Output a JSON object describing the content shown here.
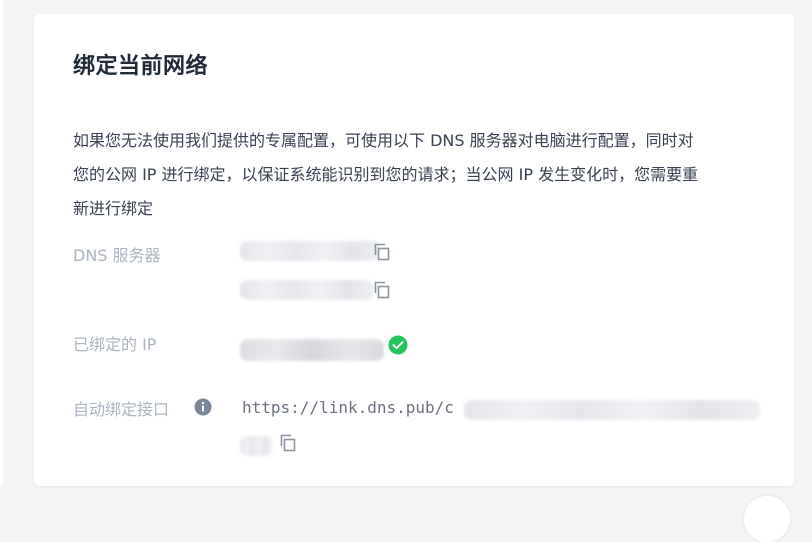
{
  "card": {
    "title": "绑定当前网络",
    "description_line1": "如果您无法使用我们提供的专属配置，可使用以下 DNS 服务器对电脑进行配置，同时对",
    "description_line2": "您的公网 IP 进行绑定，以保证系统能识别到您的请求；当公网 IP 发生变化时，您需要重",
    "description_line3": "新进行绑定"
  },
  "dns_servers": {
    "label": "DNS 服务器",
    "icons": [
      "copy-icon",
      "copy-icon"
    ]
  },
  "bound_ip": {
    "label": "已绑定的 IP",
    "status_icon": "check-circle-icon",
    "status_color": "#22c55e"
  },
  "auto_bind": {
    "label": "自动绑定接口",
    "info_icon": "info-icon",
    "url_visible": "https://link.dns.pub/c",
    "copy_icon": "copy-icon"
  },
  "colors": {
    "label": "#aab3c1",
    "title": "#1f2937",
    "text": "#374151",
    "accent_green": "#22c55e"
  }
}
